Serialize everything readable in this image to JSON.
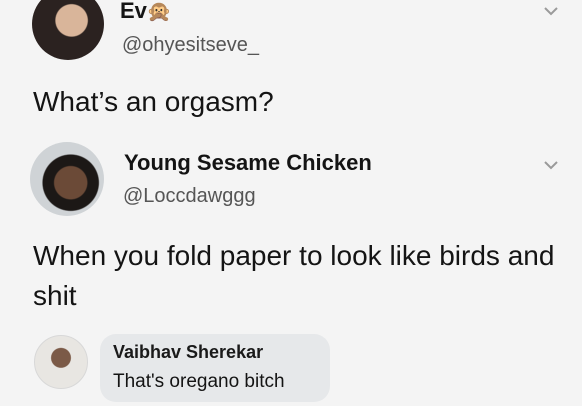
{
  "post": {
    "author_name": "Ev",
    "author_emoji": "🙊",
    "author_handle": "@ohyesitseve_",
    "text": "What’s an orgasm?",
    "avatar_icon": "profile-photo",
    "menu_icon": "chevron-down-icon"
  },
  "reply": {
    "author_name": "Young Sesame Chicken",
    "author_handle": "@Loccdawggg",
    "text": "When you fold paper to look like birds and shit",
    "avatar_icon": "profile-photo",
    "menu_icon": "chevron-down-icon"
  },
  "comment": {
    "author_name": "Vaibhav Sherekar",
    "text": "That's oregano bitch",
    "avatar_icon": "profile-photo"
  }
}
